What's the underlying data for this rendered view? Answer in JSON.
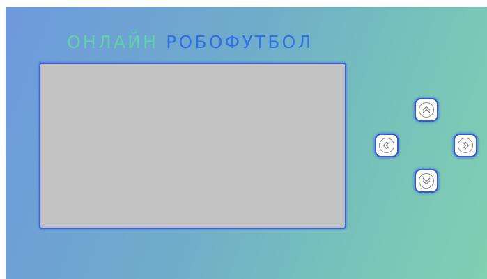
{
  "title": {
    "part1": "ОНЛАЙН",
    "part2": "РОБОФУТБОЛ"
  },
  "colors": {
    "title_part1": "#5fd2a6",
    "title_part2": "#2f6fe8",
    "screen": "#c3c3c3",
    "button_border": "#3559d6"
  },
  "controls": {
    "up_icon": "chevron-double-up-icon",
    "left_icon": "chevron-double-left-icon",
    "right_icon": "chevron-double-right-icon",
    "down_icon": "chevron-double-down-icon"
  }
}
